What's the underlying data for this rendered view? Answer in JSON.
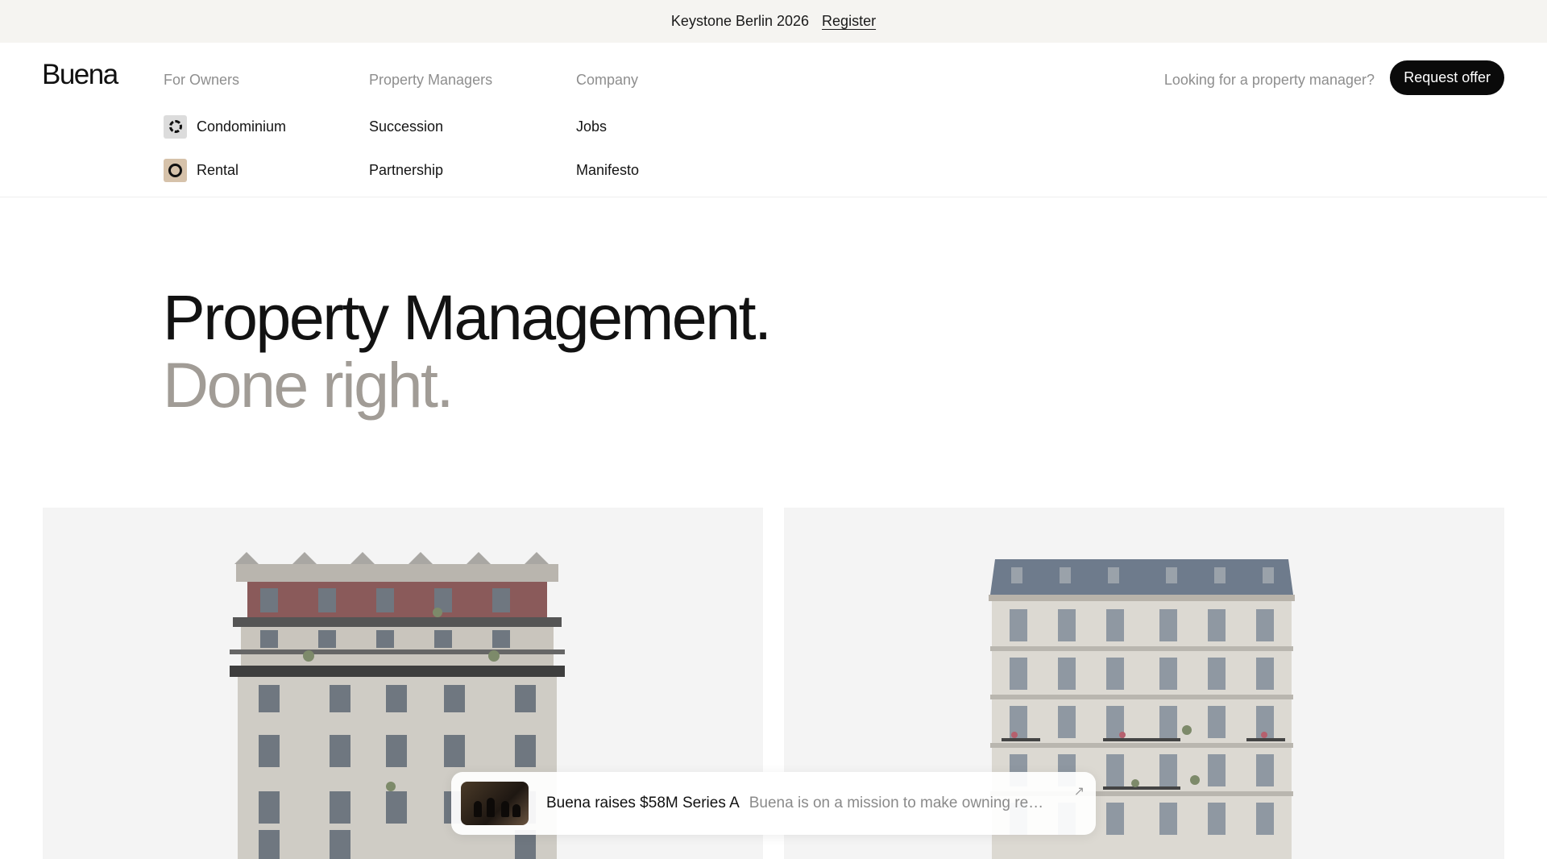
{
  "announcement": {
    "text": "Keystone Berlin 2026",
    "link": "Register"
  },
  "nav": {
    "logo": "Buena",
    "columns": [
      {
        "heading": "For Owners",
        "items": [
          "Condominium",
          "Rental"
        ]
      },
      {
        "heading": "Property Managers",
        "items": [
          "Succession",
          "Partnership"
        ]
      },
      {
        "heading": "Company",
        "items": [
          "Jobs",
          "Manifesto"
        ]
      }
    ],
    "question": "Looking for a property manager?",
    "cta": "Request offer"
  },
  "hero": {
    "line1": "Property Management.",
    "line2": "Done right."
  },
  "toast": {
    "title": "Buena raises $58M Series A",
    "description": "Buena is on a mission to make owning real estate effortless",
    "icon": "arrow-up-right-icon"
  },
  "colors": {
    "announcement_bg": "#f5f4f1",
    "cta_bg": "#0a0a0a",
    "muted_text": "#8e8e8e",
    "hero_secondary": "#a19c96",
    "card_bg": "#f4f4f4",
    "rental_icon_bg": "#d6c2aa"
  }
}
